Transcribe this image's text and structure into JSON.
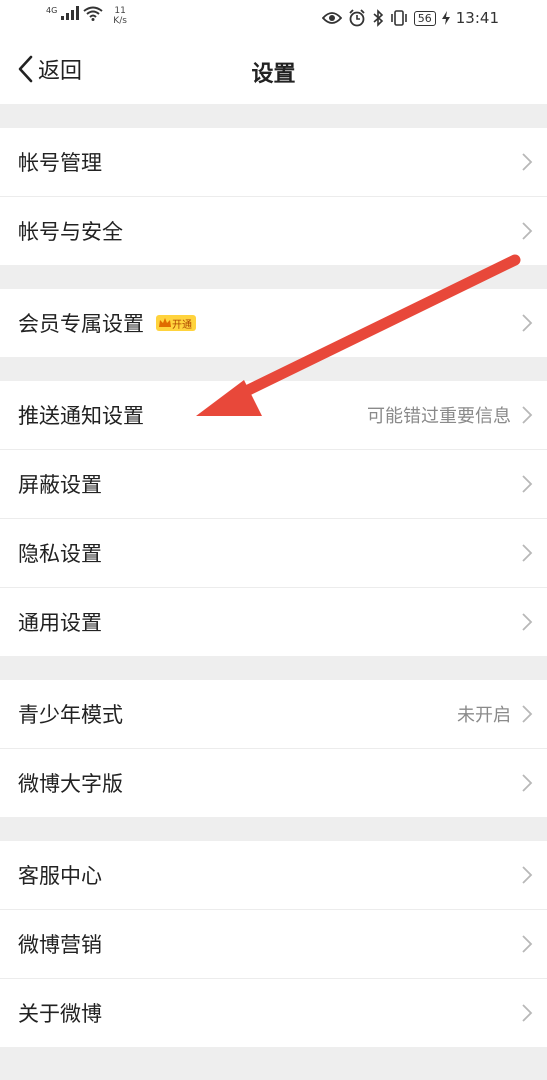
{
  "status_bar": {
    "network": "4G",
    "speed_value": "11",
    "speed_unit": "K/s",
    "battery": "56",
    "time": "13:41"
  },
  "nav": {
    "back_label": "返回",
    "title": "设置"
  },
  "groups": [
    {
      "items": [
        {
          "label": "帐号管理"
        },
        {
          "label": "帐号与安全"
        }
      ]
    },
    {
      "items": [
        {
          "label": "会员专属设置",
          "badge": "开通"
        }
      ]
    },
    {
      "items": [
        {
          "label": "推送通知设置",
          "value": "可能错过重要信息"
        },
        {
          "label": "屏蔽设置"
        },
        {
          "label": "隐私设置"
        },
        {
          "label": "通用设置"
        }
      ]
    },
    {
      "items": [
        {
          "label": "青少年模式",
          "value": "未开启"
        },
        {
          "label": "微博大字版"
        }
      ]
    },
    {
      "items": [
        {
          "label": "客服中心"
        },
        {
          "label": "微博营销"
        },
        {
          "label": "关于微博"
        }
      ]
    }
  ],
  "colors": {
    "annotation_arrow": "#e8483a",
    "badge_bg": "#ffd33d",
    "chevron": "#b8b8b8"
  }
}
